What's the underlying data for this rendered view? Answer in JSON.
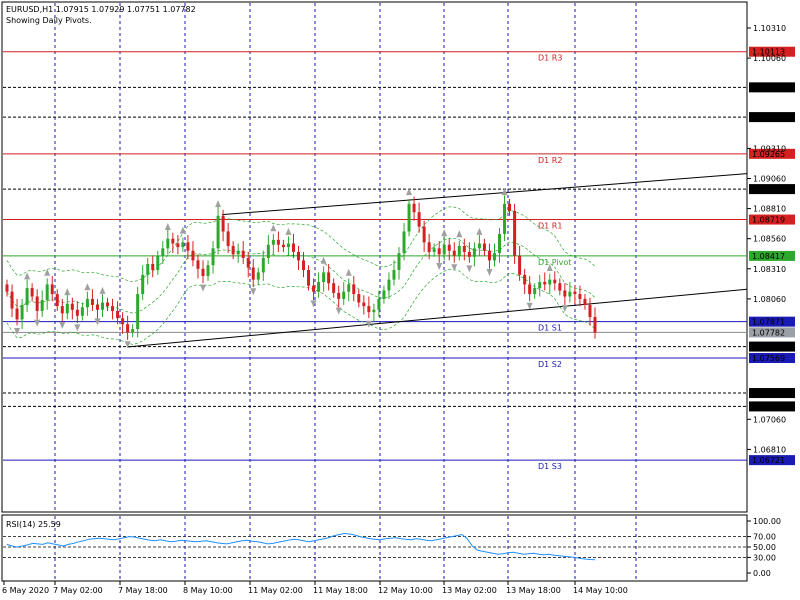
{
  "header": {
    "symbol_line": "EURUSD,H1  1.07915 1.07929 1.07751 1.07782",
    "subtitle": "Showing Daily Pivots."
  },
  "rsi": {
    "label": "RSI(14) 25.59",
    "ticks": [
      "100.00",
      "70.00",
      "50.00",
      "30.00",
      "0.00"
    ],
    "values": [
      55,
      52,
      50,
      52,
      54,
      57,
      56,
      55,
      58,
      56,
      54,
      52,
      55,
      57,
      60,
      62,
      65,
      66,
      67,
      66,
      65,
      64,
      66,
      68,
      70,
      69,
      67,
      65,
      63,
      62,
      64,
      62,
      60,
      61,
      63,
      62,
      61,
      60,
      61,
      62,
      60,
      58,
      57,
      56,
      58,
      60,
      62,
      63,
      61,
      60,
      58,
      56,
      57,
      59,
      61,
      63,
      65,
      64,
      62,
      60,
      62,
      64,
      66,
      68,
      72,
      74,
      76,
      75,
      73,
      70,
      68,
      66,
      65,
      64,
      66,
      67,
      68,
      66,
      65,
      64,
      66,
      65,
      63,
      62,
      64,
      66,
      68,
      70,
      72,
      74,
      66,
      52,
      44,
      42,
      40,
      38,
      36,
      37,
      39,
      40,
      38,
      36,
      37,
      38,
      36,
      35,
      36,
      34,
      33,
      32,
      31,
      30,
      28,
      27,
      26,
      25.59
    ]
  },
  "chart_data": {
    "type": "candlestick",
    "symbol": "EURUSD",
    "timeframe": "H1",
    "y_ticks": [
      "1.10310",
      "1.10060",
      "1.09310",
      "1.09060",
      "1.08810",
      "1.08560",
      "1.08310",
      "1.08060",
      "1.07060",
      "1.06810"
    ],
    "ylim": [
      1.065,
      1.105
    ],
    "x_ticks": [
      "6 May 2020",
      "7 May 02:00",
      "7 May 18:00",
      "8 May 10:00",
      "11 May 02:00",
      "11 May 18:00",
      "12 May 10:00",
      "13 May 02:00",
      "13 May 18:00",
      "14 May 10:00"
    ],
    "pivots": [
      {
        "label": "D1 R3",
        "value": "1.10113",
        "color": "#d42020"
      },
      {
        "label": "D1 R2",
        "value": "1.09265",
        "color": "#d42020"
      },
      {
        "label": "D1 R1",
        "value": "1.08719",
        "color": "#d42020"
      },
      {
        "label": "D1 Pivot",
        "value": "1.08417",
        "color": "#2ca82c"
      },
      {
        "label": "D1 S1",
        "value": "1.07871",
        "color": "#1a1ab4"
      },
      {
        "label": "D1 S2",
        "value": "1.07569",
        "color": "#1a1ab4"
      },
      {
        "label": "D1 S3",
        "value": "1.06721",
        "color": "#1a1ab4"
      }
    ],
    "levels": [
      "1.09817",
      "1.09570",
      "1.08972",
      "1.07664",
      "1.07278",
      "1.07167"
    ],
    "current_price": "1.07782",
    "closes": [
      1.0812,
      1.0798,
      1.0789,
      1.0801,
      1.0815,
      1.0808,
      1.0796,
      1.0805,
      1.0818,
      1.081,
      1.08,
      1.0794,
      1.0802,
      1.0797,
      1.0792,
      1.0799,
      1.0806,
      1.0801,
      1.0797,
      1.0803,
      1.08,
      1.0796,
      1.079,
      1.0785,
      1.0778,
      1.0781,
      1.081,
      1.0826,
      1.0835,
      1.083,
      1.0842,
      1.0848,
      1.0856,
      1.0852,
      1.0849,
      1.0853,
      1.0846,
      1.0838,
      1.0831,
      1.0825,
      1.0834,
      1.0848,
      1.0875,
      1.0862,
      1.085,
      1.0843,
      1.0846,
      1.084,
      1.0832,
      1.0822,
      1.0828,
      1.084,
      1.0851,
      1.0855,
      1.0851,
      1.0849,
      1.0852,
      1.0845,
      1.0838,
      1.083,
      1.0817,
      1.0812,
      1.082,
      1.0828,
      1.0819,
      1.0811,
      1.0806,
      1.0812,
      1.0818,
      1.081,
      1.0803,
      1.08,
      1.0795,
      1.0797,
      1.0806,
      1.0813,
      1.0822,
      1.083,
      1.0844,
      1.0862,
      1.0885,
      1.0878,
      1.0866,
      1.0853,
      1.0845,
      1.0848,
      1.0843,
      1.0851,
      1.0846,
      1.0842,
      1.085,
      1.0845,
      1.0841,
      1.0848,
      1.0852,
      1.0846,
      1.0838,
      1.0844,
      1.086,
      1.0885,
      1.0879,
      1.0842,
      1.0826,
      1.0818,
      1.081,
      1.0815,
      1.082,
      1.0818,
      1.0822,
      1.0819,
      1.0813,
      1.0808,
      1.0812,
      1.081,
      1.0806,
      1.0801,
      1.0791,
      1.0778
    ],
    "grid": true,
    "legend": "none"
  }
}
